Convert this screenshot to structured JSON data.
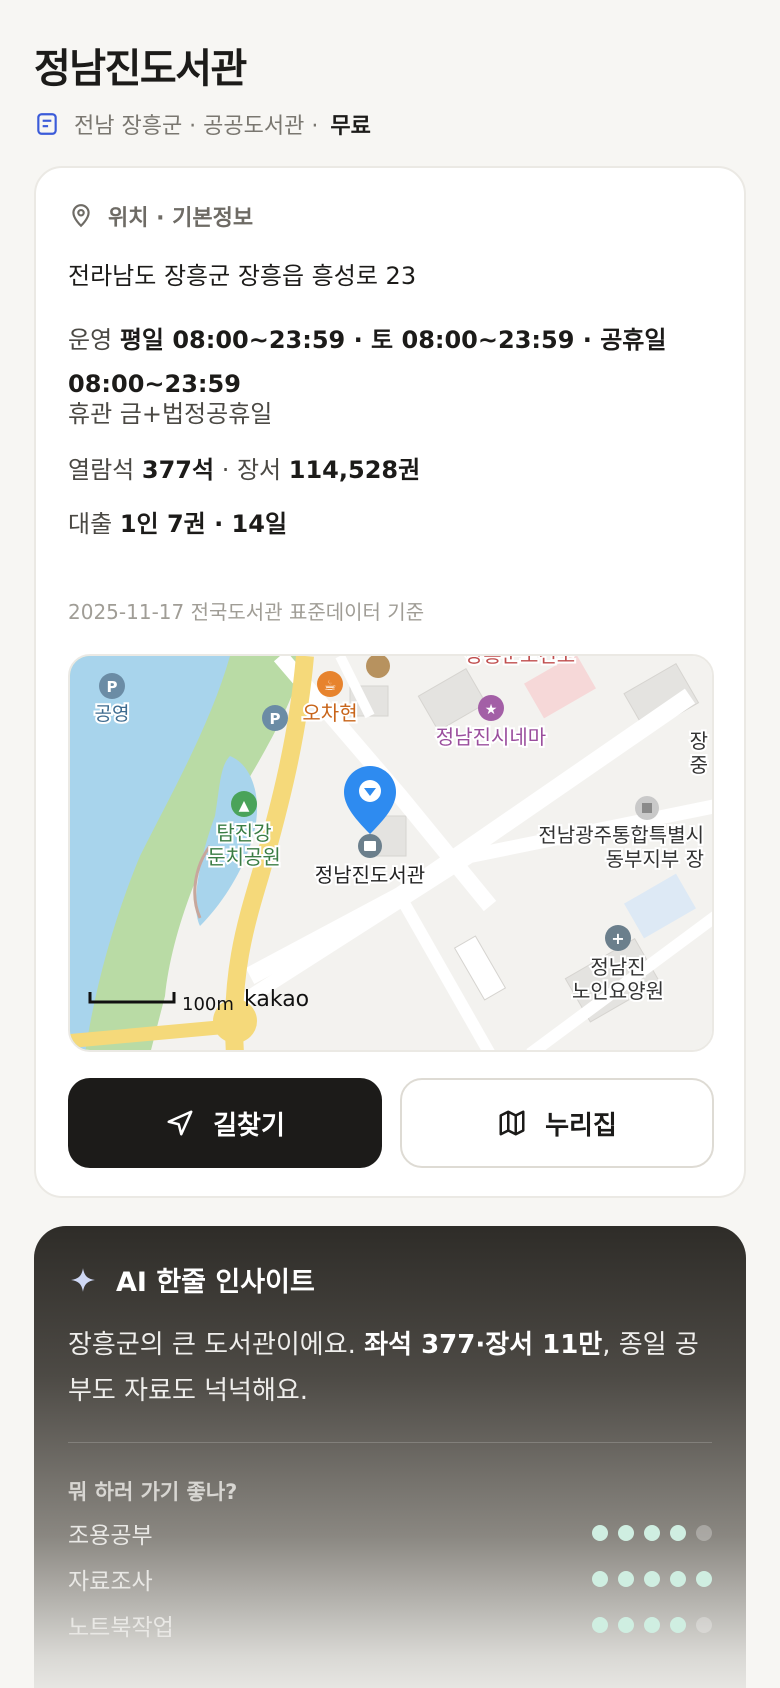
{
  "header": {
    "title": "정남진도서관",
    "meta": "전남 장흥군 · 공공도서관 ·",
    "fee": "무료"
  },
  "info": {
    "section_title": "위치 · 기본정보",
    "address": "전라남도 장흥군 장흥읍 흥성로 23",
    "hours_label": "운영",
    "hours_value": "평일 08:00~23:59 · 토 08:00~23:59 · 공휴일 08:00~23:59",
    "closed": "휴관 금+법정공휴일",
    "seats_label": "열람석",
    "seats_value": "377석",
    "books_label": "· 장서",
    "books_value": "114,528권",
    "loan_label": "대출",
    "loan_value": "1인 7권 · 14일",
    "source": "2025-11-17 전국도서관 표준데이터 기준"
  },
  "map": {
    "pin_label": "정남진도서관",
    "labels": {
      "gongyeong": "공영",
      "ochahyeon": "오차현",
      "cinema": "정남진시네마",
      "top_cut": "장흥군보건소",
      "park_line1": "탐진강",
      "park_line2": "둔치공원",
      "office_line1": "전남광주통합특별시",
      "office_line2": "동부지부 장",
      "edge_line1": "장",
      "edge_line2": "중",
      "nursing_line1": "정남진",
      "nursing_line2": "노인요양원"
    },
    "scale": "100m",
    "brand": "kakao"
  },
  "actions": {
    "directions": "길찾기",
    "nurijip": "누리집"
  },
  "ai": {
    "title": "AI 한줄 인사이트",
    "text_a": "장흥군의 큰 도서관이에요. ",
    "text_b": "좌석 377·장서 11만",
    "text_c": ", 종일 공부도 자료도 넉넉해요.",
    "question": "뭐 하러 가기 좋나?",
    "ratings": [
      {
        "label": "조용공부",
        "score": 4,
        "max": 5
      },
      {
        "label": "자료조사",
        "score": 5,
        "max": 5
      },
      {
        "label": "노트북작업",
        "score": 4,
        "max": 5
      }
    ]
  },
  "colors": {
    "accent_dark": "#1c1b19",
    "map_water": "#a8d4ec",
    "map_road": "#f5d97a",
    "pin_blue": "#2e8bf0",
    "rating_on": "#cfeee1"
  }
}
